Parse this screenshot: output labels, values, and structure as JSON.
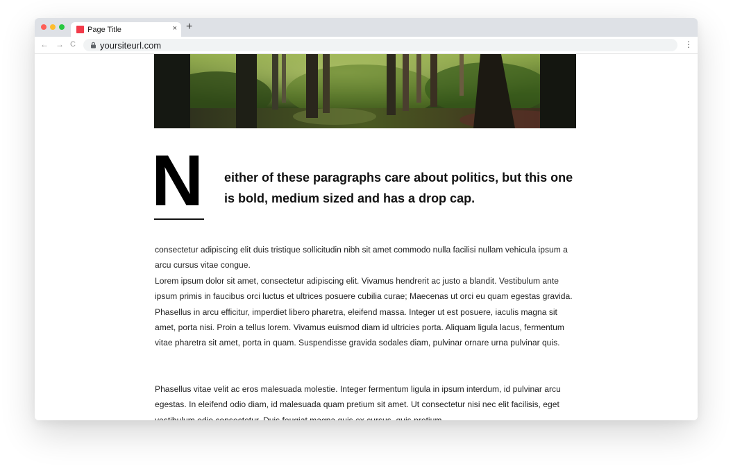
{
  "browser": {
    "tab_title": "Page Title",
    "tab_close": "×",
    "new_tab": "+",
    "url": "yoursiteurl.com",
    "nav": {
      "back": "←",
      "forward": "→",
      "reload": "C"
    },
    "menu": "⋮",
    "icons": [
      "close-icon",
      "plus-icon",
      "back-arrow-icon",
      "forward-arrow-icon",
      "reload-icon",
      "lock-icon",
      "kebab-menu-icon"
    ]
  },
  "article": {
    "hero_image": "forest-photo",
    "dropcap": "N",
    "lead": "either of these paragraphs care about politics, but this one is bold, medium sized and has a drop cap.",
    "paragraph_1": "consectetur adipiscing elit duis tristique sollicitudin nibh sit amet commodo nulla facilisi nullam vehicula ipsum a arcu cursus vitae congue.\nLorem ipsum dolor sit amet, consectetur adipiscing elit. Vivamus hendrerit ac justo a blandit. Vestibulum ante ipsum primis in faucibus orci luctus et ultrices posuere cubilia curae; Maecenas ut orci eu quam egestas gravida. Phasellus in arcu efficitur, imperdiet libero pharetra, eleifend massa. Integer ut est posuere, iaculis magna sit amet, porta nisi. Proin a tellus lorem. Vivamus euismod diam id ultricies porta. Aliquam ligula lacus, fermentum vitae pharetra sit amet, porta in quam. Suspendisse gravida sodales diam, pulvinar ornare urna pulvinar quis.",
    "paragraph_2": "Phasellus vitae velit ac eros malesuada molestie. Integer fermentum ligula in ipsum interdum, id pulvinar arcu egestas. In eleifend odio diam, id malesuada quam pretium sit amet. Ut consectetur nisi nec elit facilisis, eget vestibulum odio consectetur. Duis feugiat magna quis ex cursus, quis pretium"
  },
  "colors": {
    "tabbar": "#dee1e6",
    "favicon": "#f23b4a",
    "traffic_red": "#fe5f57",
    "traffic_yellow": "#febc2e",
    "traffic_green": "#28c840"
  }
}
